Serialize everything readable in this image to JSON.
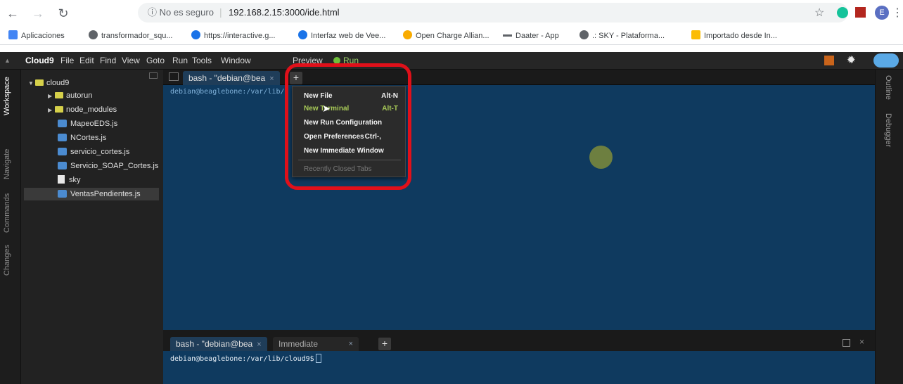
{
  "browser": {
    "security_label": "ⓘ No es seguro",
    "url": "192.168.2.15:3000/ide.html",
    "bookmarks": [
      {
        "label": "Aplicaciones",
        "color": "#4285f4"
      },
      {
        "label": "transformador_squ...",
        "color": "#5f6368"
      },
      {
        "label": "https://interactive.g...",
        "color": "#1a73e8"
      },
      {
        "label": "Interfaz web de Vee...",
        "color": "#1a73e8"
      },
      {
        "label": "Open Charge Allian...",
        "color": "#f9ab00"
      },
      {
        "label": "Daater - App",
        "color": "#5f6368"
      },
      {
        "label": ".: SKY - Plataforma...",
        "color": "#5f6368"
      },
      {
        "label": "Importado desde In...",
        "color": "#fbbc04"
      }
    ],
    "profile_initial": "E"
  },
  "menubar": {
    "items": [
      "Cloud9",
      "File",
      "Edit",
      "Find",
      "View",
      "Goto",
      "Run",
      "Tools",
      "Window",
      "Preview",
      "Run"
    ]
  },
  "left_tabs": [
    "Workspace",
    "Navigate",
    "Commands",
    "Changes"
  ],
  "right_tabs": [
    "Outline",
    "Debugger"
  ],
  "tree": [
    {
      "label": "cloud9",
      "type": "folder-open"
    },
    {
      "label": "autorun",
      "type": "folder"
    },
    {
      "label": "node_modules",
      "type": "folder"
    },
    {
      "label": "MapeoEDS.js",
      "type": "js"
    },
    {
      "label": "NCortes.js",
      "type": "js"
    },
    {
      "label": "servicio_cortes.js",
      "type": "js"
    },
    {
      "label": "Servicio_SOAP_Cortes.js",
      "type": "js"
    },
    {
      "label": "sky",
      "type": "file"
    },
    {
      "label": "VentasPendientes.js",
      "type": "js"
    }
  ],
  "editor": {
    "top_tab": "bash - \"debian@bea",
    "top_prompt": "debian@beaglebone:/var/lib/c",
    "bottom_tabs": [
      "bash - \"debian@bea",
      "Immediate"
    ],
    "bottom_prompt": "debian@beaglebone:/var/lib/cloud9$"
  },
  "dropdown": {
    "items": [
      {
        "label": "New File",
        "shortcut": "Alt-N"
      },
      {
        "label": "New Terminal",
        "shortcut": "Alt-T"
      },
      {
        "label": "New Run Configuration",
        "shortcut": ""
      },
      {
        "label": "Open Preferences",
        "shortcut": "Ctrl-,"
      },
      {
        "label": "New Immediate Window",
        "shortcut": ""
      },
      {
        "label": "Recently Closed Tabs",
        "shortcut": ""
      }
    ]
  }
}
